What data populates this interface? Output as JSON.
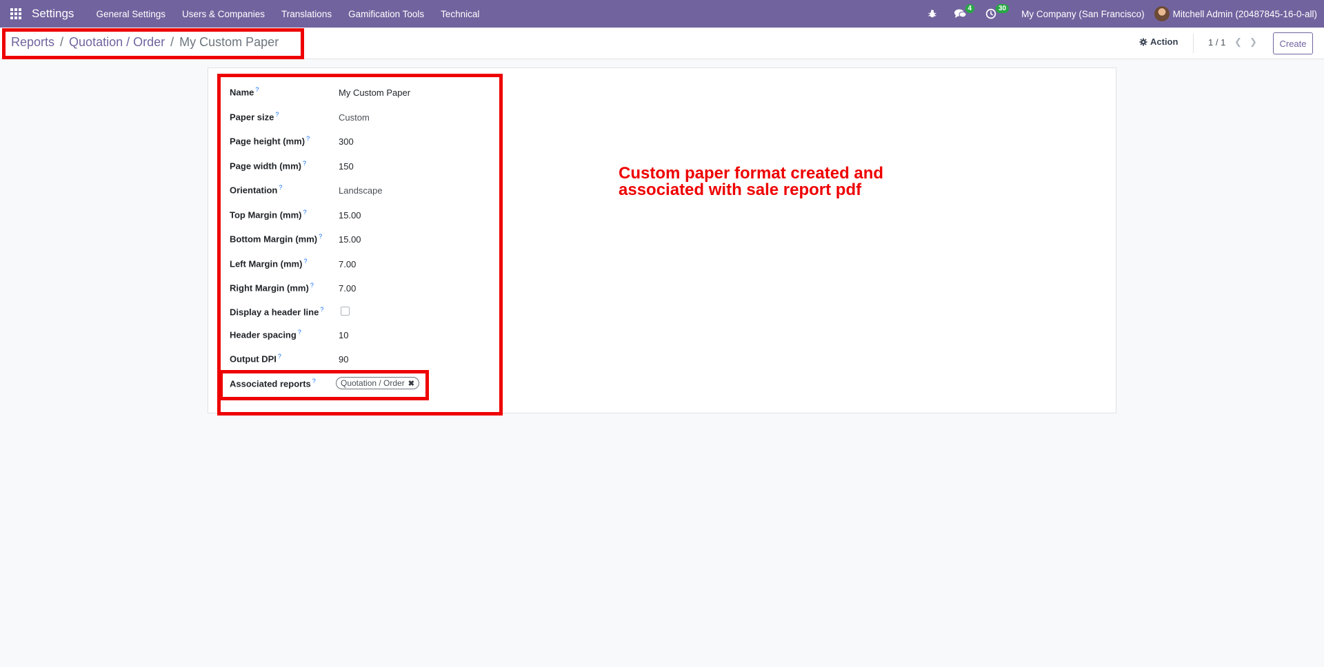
{
  "navbar": {
    "app_title": "Settings",
    "menu": [
      "General Settings",
      "Users & Companies",
      "Translations",
      "Gamification Tools",
      "Technical"
    ],
    "messages_count": "4",
    "activities_count": "30",
    "company": "My Company (San Francisco)",
    "user": "Mitchell Admin (20487845-16-0-all)",
    "accent_color": "#71639e"
  },
  "breadcrumb": {
    "items": [
      "Reports",
      "Quotation / Order"
    ],
    "current": "My Custom Paper",
    "separator": "/"
  },
  "control": {
    "action_label": "Action",
    "pager": "1 / 1",
    "create_label": "Create"
  },
  "form": {
    "help_mark": "?",
    "fields": [
      {
        "label": "Name",
        "value": "My Custom Paper"
      },
      {
        "label": "Paper size",
        "value": "Custom"
      },
      {
        "label": "Page height (mm)",
        "value": "300"
      },
      {
        "label": "Page width (mm)",
        "value": "150"
      },
      {
        "label": "Orientation",
        "value": "Landscape"
      },
      {
        "label": "Top Margin (mm)",
        "value": "15.00"
      },
      {
        "label": "Bottom Margin (mm)",
        "value": "15.00"
      },
      {
        "label": "Left Margin (mm)",
        "value": "7.00"
      },
      {
        "label": "Right Margin (mm)",
        "value": "7.00"
      },
      {
        "label": "Display a header line",
        "checked": false
      },
      {
        "label": "Header spacing",
        "value": "10"
      },
      {
        "label": "Output DPI",
        "value": "90"
      },
      {
        "label": "Associated reports",
        "tag": "Quotation / Order"
      }
    ]
  },
  "annotation": {
    "line1": "Custom paper format created and",
    "line2": "associated with sale report pdf",
    "color": "#ee0000"
  }
}
